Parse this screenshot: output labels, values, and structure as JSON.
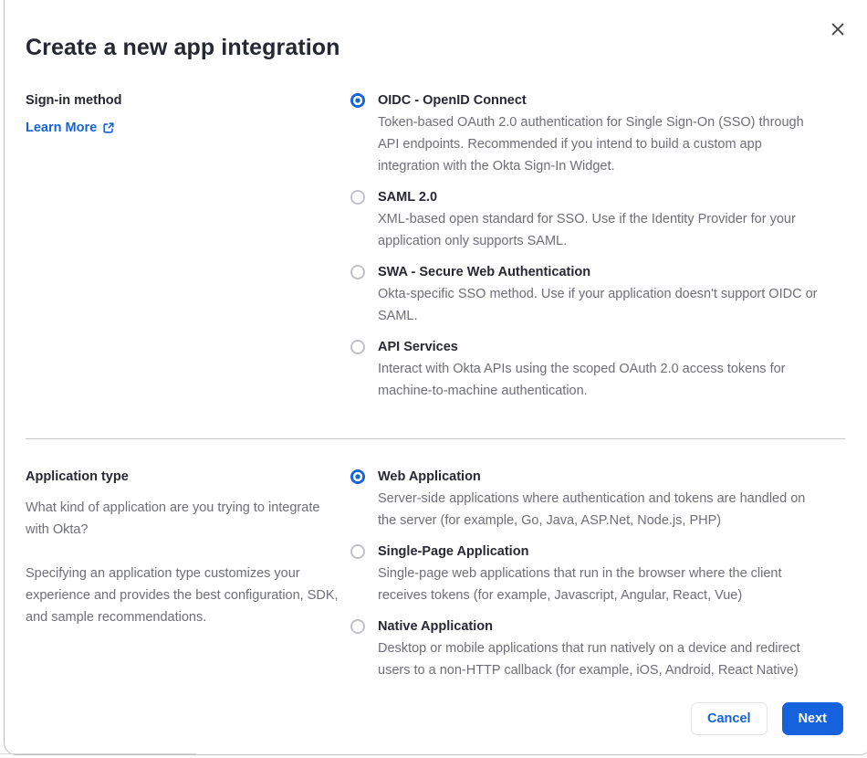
{
  "modal": {
    "title": "Create a new app integration"
  },
  "sign_in": {
    "label": "Sign-in method",
    "learn_more": "Learn More",
    "options": [
      {
        "label": "OIDC - OpenID Connect",
        "description": "Token-based OAuth 2.0 authentication for Single Sign-On (SSO) through API endpoints. Recommended if you intend to build a custom app integration with the Okta Sign-In Widget.",
        "selected": true
      },
      {
        "label": "SAML 2.0",
        "description": "XML-based open standard for SSO. Use if the Identity Provider for your application only supports SAML.",
        "selected": false
      },
      {
        "label": "SWA - Secure Web Authentication",
        "description": "Okta-specific SSO method. Use if your application doesn't support OIDC or SAML.",
        "selected": false
      },
      {
        "label": "API Services",
        "description": "Interact with Okta APIs using the scoped OAuth 2.0 access tokens for machine-to-machine authentication.",
        "selected": false
      }
    ]
  },
  "app_type": {
    "label": "Application type",
    "paragraphs": [
      "What kind of application are you trying to integrate with Okta?",
      "Specifying an application type customizes your experience and provides the best configuration, SDK, and sample recommendations."
    ],
    "options": [
      {
        "label": "Web Application",
        "description": "Server-side applications where authentication and tokens are handled on the server (for example, Go, Java, ASP.Net, Node.js, PHP)",
        "selected": true
      },
      {
        "label": "Single-Page Application",
        "description": "Single-page web applications that run in the browser where the client receives tokens (for example, Javascript, Angular, React, Vue)",
        "selected": false
      },
      {
        "label": "Native Application",
        "description": "Desktop or mobile applications that run natively on a device and redirect users to a non-HTTP callback (for example, iOS, Android, React Native)",
        "selected": false
      }
    ]
  },
  "footer": {
    "cancel_label": "Cancel",
    "next_label": "Next"
  },
  "colors": {
    "primary_blue": "#1662dd",
    "text_dark": "#272833",
    "text_gray": "#6e6e78"
  }
}
